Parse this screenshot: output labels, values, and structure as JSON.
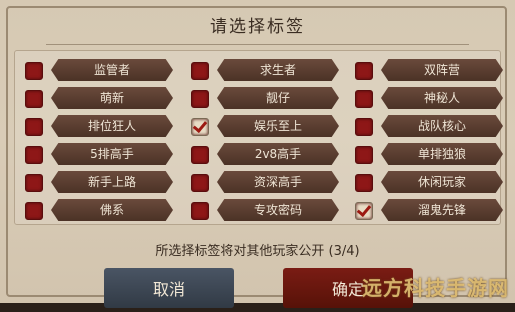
{
  "dialog": {
    "title": "请选择标签",
    "hint": "所选择标签将对其他玩家公开 (3/4)",
    "cancel_label": "取消",
    "confirm_label": "确定"
  },
  "tags": [
    {
      "label": "监管者",
      "checked": false
    },
    {
      "label": "求生者",
      "checked": false
    },
    {
      "label": "双阵营",
      "checked": false
    },
    {
      "label": "萌新",
      "checked": false
    },
    {
      "label": "靓仔",
      "checked": false
    },
    {
      "label": "神秘人",
      "checked": false
    },
    {
      "label": "排位狂人",
      "checked": false
    },
    {
      "label": "娱乐至上",
      "checked": true
    },
    {
      "label": "战队核心",
      "checked": false
    },
    {
      "label": "5排高手",
      "checked": false
    },
    {
      "label": "2v8高手",
      "checked": false
    },
    {
      "label": "单排独狼",
      "checked": false
    },
    {
      "label": "新手上路",
      "checked": false
    },
    {
      "label": "资深高手",
      "checked": false
    },
    {
      "label": "休闲玩家",
      "checked": false
    },
    {
      "label": "佛系",
      "checked": false
    },
    {
      "label": "专攻密码",
      "checked": false
    },
    {
      "label": "溜鬼先锋",
      "checked": true
    }
  ],
  "watermark": "远方科技手游网",
  "colors": {
    "checkbox_unchecked": "#8e1717",
    "tag_bg": "#5a3d30",
    "confirm": "#6b1810",
    "cancel": "#3e4754"
  }
}
